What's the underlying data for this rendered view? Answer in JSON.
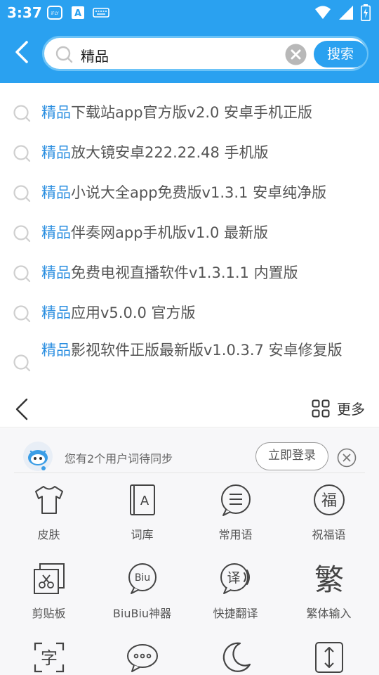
{
  "status_bar": {
    "time": "3:37",
    "notif_icons": [
      "iflytek-icon",
      "a-icon",
      "keyboard-icon"
    ],
    "right_icons": [
      "wifi-icon",
      "signal-icon",
      "battery-charging-icon"
    ]
  },
  "search": {
    "query": "精品",
    "button_label": "搜索"
  },
  "results": [
    {
      "highlight": "精品",
      "rest": "下载站app官方版v2.0 安卓手机正版"
    },
    {
      "highlight": "精品",
      "rest": "放大镜安卓222.22.48 手机版"
    },
    {
      "highlight": "精品",
      "rest": "小说大全app免费版v1.3.1 安卓纯净版"
    },
    {
      "highlight": "精品",
      "rest": "伴奏网app手机版v1.0 最新版"
    },
    {
      "highlight": "精品",
      "rest": "免费电视直播软件v1.3.1.1 内置版"
    },
    {
      "highlight": "精品",
      "rest": "应用v5.0.0 官方版"
    },
    {
      "highlight": "精品",
      "rest": "影视软件正版最新版v1.0.3.7 安卓修复版"
    }
  ],
  "results_nav": {
    "more_label": "更多"
  },
  "keyboard_panel": {
    "sync_text": "您有2个用户词待同步",
    "login_label": "立即登录",
    "tools": [
      {
        "label": "皮肤",
        "icon": "tshirt-icon"
      },
      {
        "label": "词库",
        "icon": "dictionary-icon"
      },
      {
        "label": "常用语",
        "icon": "phrases-icon"
      },
      {
        "label": "祝福语",
        "icon": "blessing-icon"
      },
      {
        "label": "剪贴板",
        "icon": "clipboard-icon"
      },
      {
        "label": "BiuBiu神器",
        "icon": "biubiu-icon"
      },
      {
        "label": "快捷翻译",
        "icon": "translate-icon"
      },
      {
        "label": "繁体输入",
        "icon": "traditional-icon"
      },
      {
        "label": "",
        "icon": "text-recognition-icon"
      },
      {
        "label": "",
        "icon": "chat-bubble-icon"
      },
      {
        "label": "",
        "icon": "night-mode-icon"
      },
      {
        "label": "",
        "icon": "resize-icon"
      }
    ],
    "colors": {
      "accent": "#2aa1f0",
      "highlight": "#2a8ee0"
    }
  }
}
